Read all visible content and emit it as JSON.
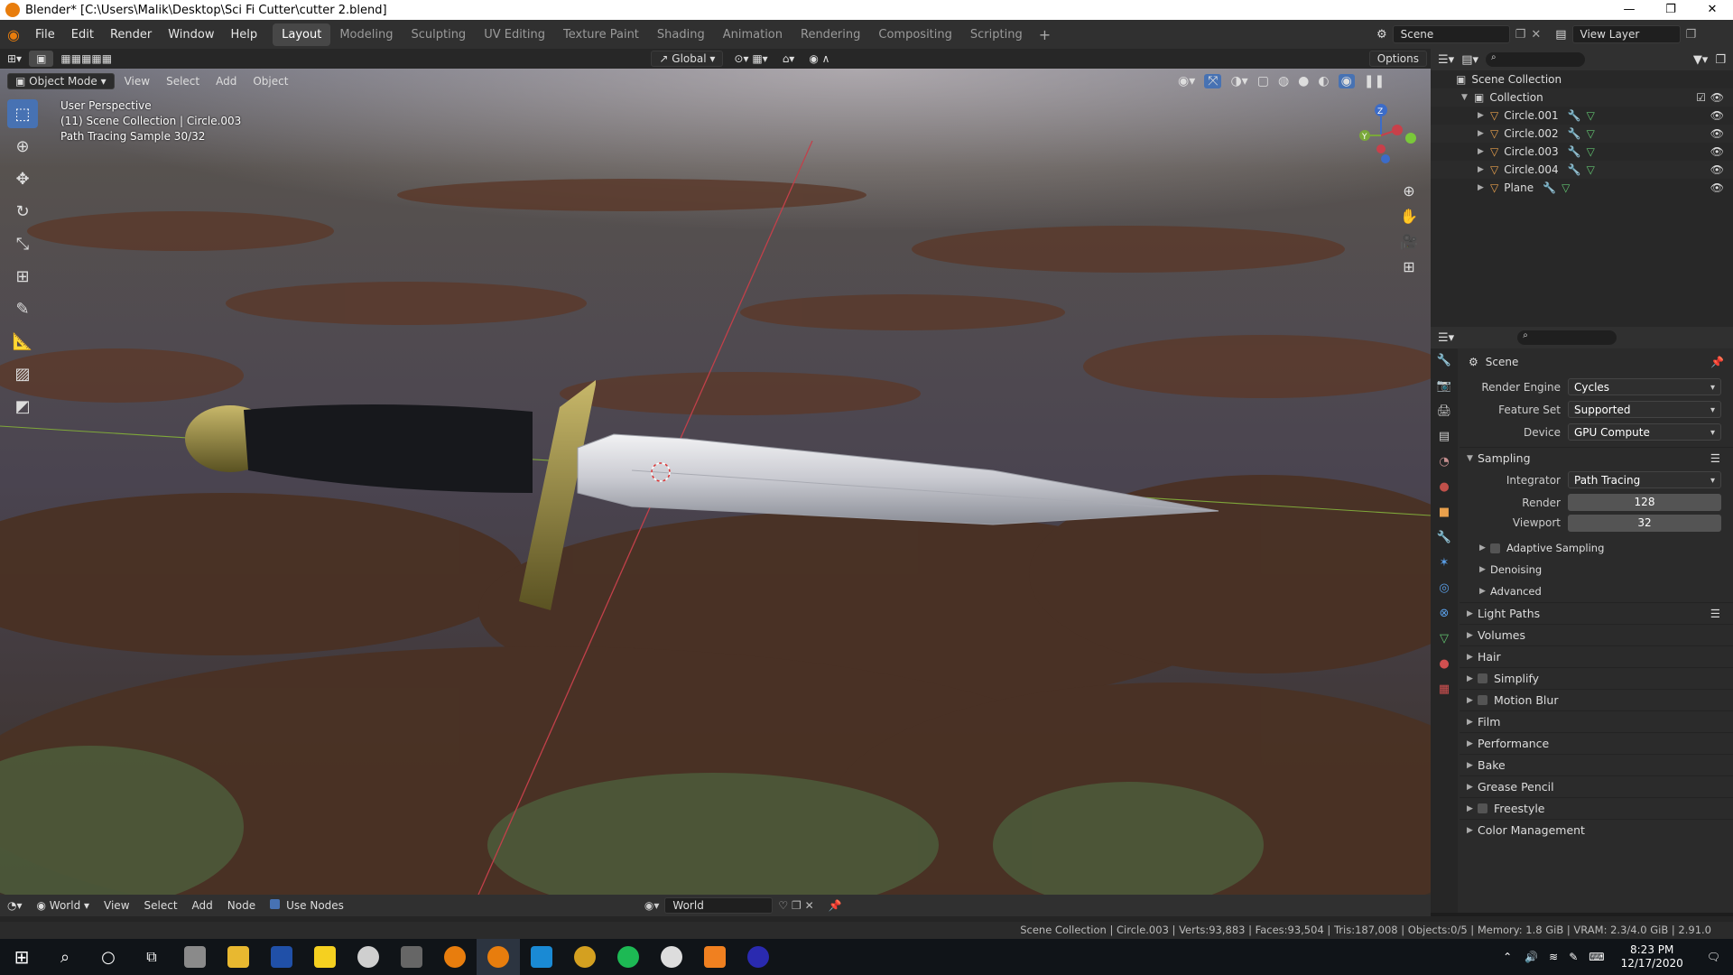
{
  "window": {
    "title": "Blender* [C:\\Users\\Malik\\Desktop\\Sci Fi Cutter\\cutter 2.blend]"
  },
  "menu": [
    "File",
    "Edit",
    "Render",
    "Window",
    "Help"
  ],
  "workspaces": [
    "Layout",
    "Modeling",
    "Sculpting",
    "UV Editing",
    "Texture Paint",
    "Shading",
    "Animation",
    "Rendering",
    "Compositing",
    "Scripting"
  ],
  "active_workspace": "Layout",
  "scene_selector": "Scene",
  "view_layer": "View Layer",
  "viewport_header": {
    "mode": "Object Mode",
    "menus": [
      "View",
      "Select",
      "Add",
      "Object"
    ],
    "orientation": "Global",
    "options": "Options"
  },
  "viewport_overlay": {
    "line1": "User Perspective",
    "line2": "(11) Scene Collection | Circle.003",
    "line3": "Path Tracing Sample 30/32"
  },
  "outliner": {
    "root": "Scene Collection",
    "collection": "Collection",
    "objects": [
      "Circle.001",
      "Circle.002",
      "Circle.003",
      "Circle.004",
      "Plane"
    ]
  },
  "properties": {
    "context": "Scene",
    "render_engine_label": "Render Engine",
    "render_engine": "Cycles",
    "feature_set_label": "Feature Set",
    "feature_set": "Supported",
    "device_label": "Device",
    "device": "GPU Compute",
    "sampling": "Sampling",
    "integrator_label": "Integrator",
    "integrator": "Path Tracing",
    "render_label": "Render",
    "render_samples": "128",
    "viewport_label": "Viewport",
    "viewport_samples": "32",
    "subsections": [
      "Adaptive Sampling",
      "Denoising",
      "Advanced"
    ],
    "sections": [
      "Light Paths",
      "Volumes",
      "Hair",
      "Simplify",
      "Motion Blur",
      "Film",
      "Performance",
      "Bake",
      "Grease Pencil",
      "Freestyle",
      "Color Management"
    ]
  },
  "node_header": {
    "world_type": "World",
    "menus": [
      "View",
      "Select",
      "Add",
      "Node"
    ],
    "use_nodes": "Use Nodes",
    "world_name": "World"
  },
  "status": "Scene Collection | Circle.003 | Verts:93,883 | Faces:93,504 | Tris:187,008 | Objects:0/5 | Memory: 1.8 GiB | VRAM: 2.3/4.0 GiB | 2.91.0",
  "taskbar": {
    "time": "8:23 PM",
    "date": "12/17/2020"
  },
  "colors": {
    "accent": "#4772b3",
    "orange": "#e87d0d"
  }
}
